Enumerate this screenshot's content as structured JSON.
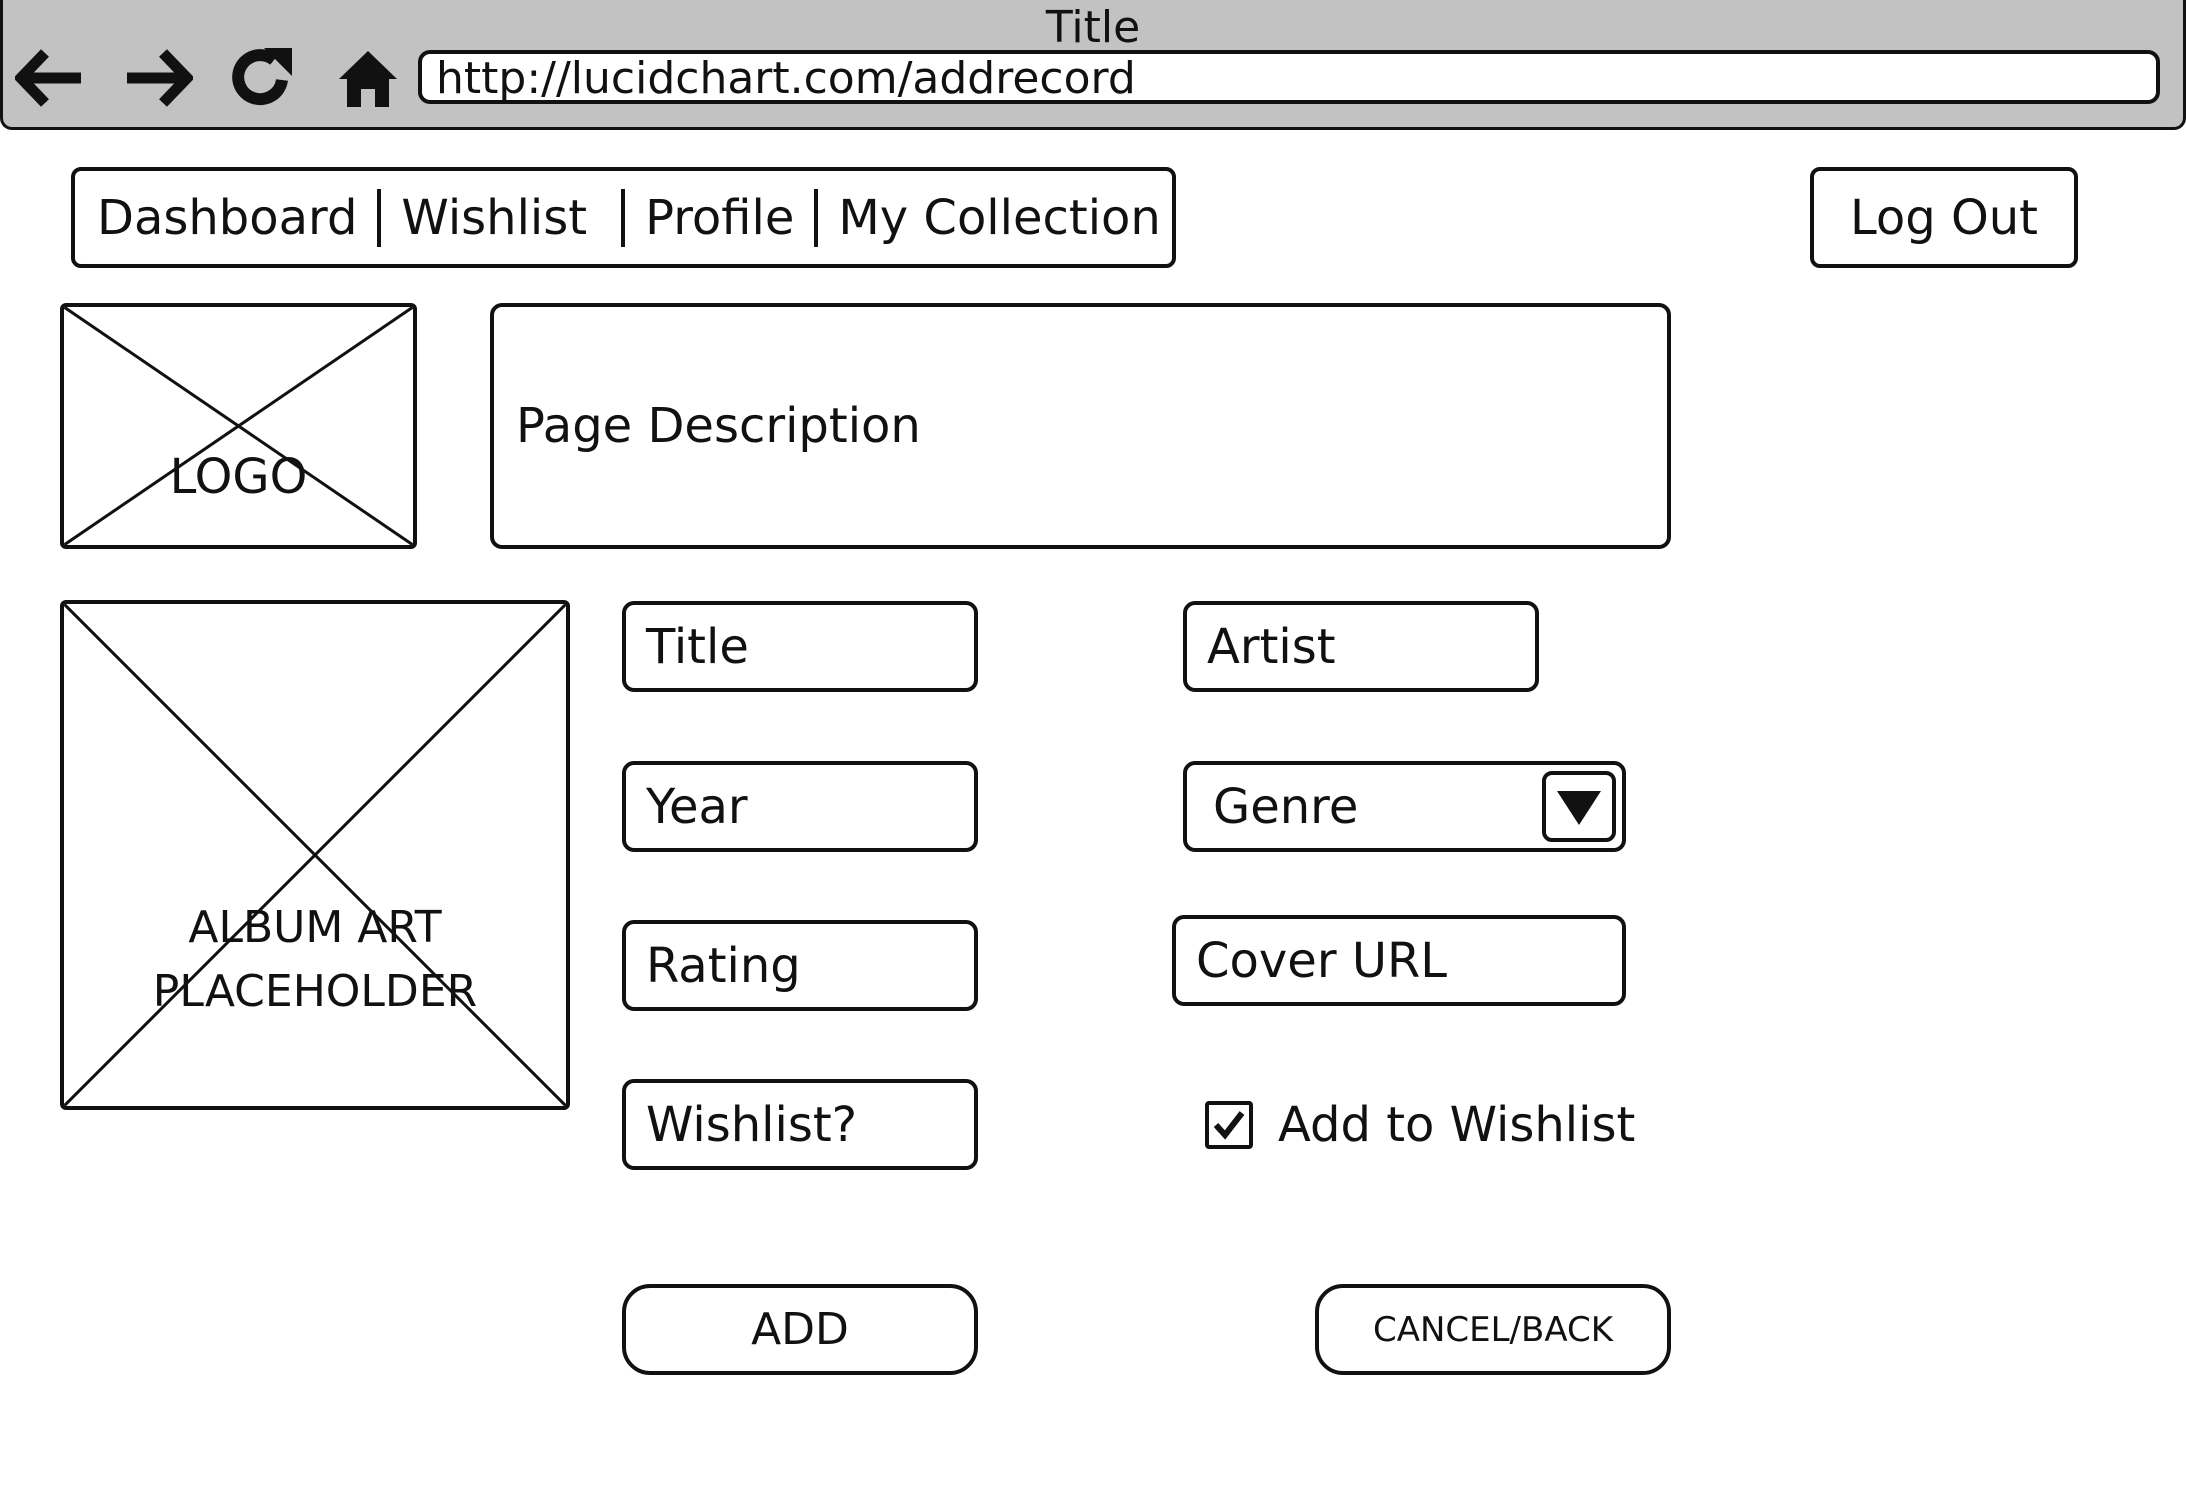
{
  "window": {
    "title": "Title",
    "url": "http://lucidchart.com/addrecord",
    "icons": [
      "back-arrow-icon",
      "forward-arrow-icon",
      "refresh-icon",
      "home-icon"
    ]
  },
  "nav": {
    "items": [
      {
        "label": "Dashboard"
      },
      {
        "label": "Wishlist"
      },
      {
        "label": "Profile"
      },
      {
        "label": "My Collection"
      }
    ],
    "logout_label": "Log Out"
  },
  "logo": {
    "label": "LOGO"
  },
  "description": {
    "text": "Page Description"
  },
  "album_art": {
    "line1": "ALBUM ART",
    "line2": "PLACEHOLDER"
  },
  "form": {
    "title": "Title",
    "year": "Year",
    "rating": "Rating",
    "wishlist": "Wishlist?",
    "artist": "Artist",
    "genre": "Genre",
    "cover_url": "Cover URL",
    "add_to_wishlist": {
      "label": "Add to Wishlist",
      "checked": true
    }
  },
  "buttons": {
    "add": "ADD",
    "cancel": "CANCEL/BACK"
  }
}
